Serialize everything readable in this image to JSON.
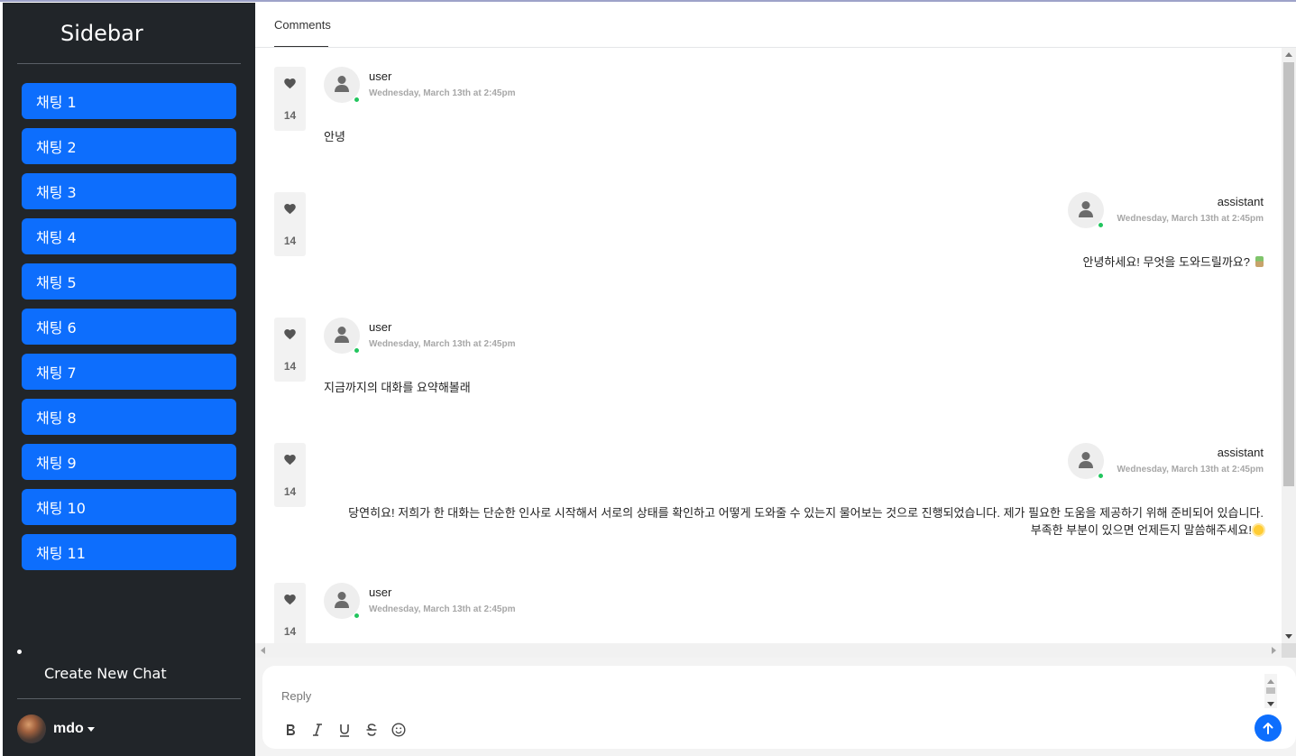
{
  "sidebar": {
    "title": "Sidebar",
    "chats": [
      "채팅 1",
      "채팅 2",
      "채팅 3",
      "채팅 4",
      "채팅 5",
      "채팅 6",
      "채팅 7",
      "채팅 8",
      "채팅 9",
      "채팅 10",
      "채팅 11"
    ],
    "create_label": "Create New Chat",
    "user_name": "mdo"
  },
  "tabs": {
    "comments": "Comments"
  },
  "messages": [
    {
      "author": "user",
      "time": "Wednesday, March 13th at 2:45pm",
      "likes": "14",
      "lines": [
        "안녕"
      ],
      "align": "left"
    },
    {
      "author": "assistant",
      "time": "Wednesday, March 13th at 2:45pm",
      "likes": "14",
      "lines": [
        "안녕하세요! 무엇을 도와드릴까요?"
      ],
      "emoji": "potted-plant-icon",
      "align": "right"
    },
    {
      "author": "user",
      "time": "Wednesday, March 13th at 2:45pm",
      "likes": "14",
      "lines": [
        "지금까지의 대화를 요약해볼래"
      ],
      "align": "left"
    },
    {
      "author": "assistant",
      "time": "Wednesday, March 13th at 2:45pm",
      "likes": "14",
      "lines": [
        "당연히요! 저희가 한 대화는 단순한 인사로 시작해서 서로의 상태를 확인하고 어떻게 도와줄 수 있는지 물어보는 것으로 진행되었습니다. 제가 필요한 도움을 제공하기 위해 준비되어 있습니다.",
        "부족한 부분이 있으면 언제든지 말씀해주세요!"
      ],
      "emoji": "sun-icon",
      "align": "right"
    },
    {
      "author": "user",
      "time": "Wednesday, March 13th at 2:45pm",
      "likes": "14",
      "lines": [],
      "align": "left"
    }
  ],
  "reply": {
    "placeholder": "Reply",
    "tools": [
      "bold-icon",
      "italic-icon",
      "underline-icon",
      "strikethrough-icon",
      "emoji-icon"
    ]
  },
  "colors": {
    "sidebar_bg": "#212529",
    "accent": "#0d6efd",
    "online": "#22c55e"
  }
}
